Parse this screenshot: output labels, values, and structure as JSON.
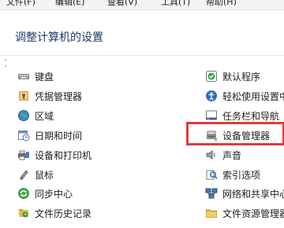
{
  "menu": [
    {
      "label": "文件(F)"
    },
    {
      "label": "编辑(E)"
    },
    {
      "label": "查看(V)"
    },
    {
      "label": "工具(T)"
    },
    {
      "label": "帮助(H)"
    }
  ],
  "page": {
    "title": "调整计算机的设置"
  },
  "left_items": [
    {
      "label": "键盘",
      "icon": "keyboard-icon"
    },
    {
      "label": "凭据管理器",
      "icon": "credential-manager-icon"
    },
    {
      "label": "区域",
      "icon": "region-globe-icon"
    },
    {
      "label": "日期和时间",
      "icon": "date-time-icon"
    },
    {
      "label": "设备和打印机",
      "icon": "devices-printers-icon"
    },
    {
      "label": "鼠标",
      "icon": "mouse-icon"
    },
    {
      "label": "同步中心",
      "icon": "sync-center-icon"
    },
    {
      "label": "文件历史记录",
      "icon": "file-history-icon"
    }
  ],
  "right_items": [
    {
      "label": "默认程序",
      "icon": "default-programs-icon"
    },
    {
      "label": "轻松使用设置中",
      "icon": "ease-of-access-icon"
    },
    {
      "label": "任务栏和导航",
      "icon": "taskbar-navigation-icon"
    },
    {
      "label": "设备管理器",
      "icon": "device-manager-icon",
      "highlighted": true
    },
    {
      "label": "声音",
      "icon": "sound-icon"
    },
    {
      "label": "索引选项",
      "icon": "indexing-options-icon"
    },
    {
      "label": "网络和共享中心",
      "icon": "network-sharing-icon"
    },
    {
      "label": "文件资源管理器",
      "icon": "file-explorer-icon"
    }
  ],
  "colors": {
    "highlight_border": "#e03a3a",
    "title": "#1e3a6e"
  }
}
